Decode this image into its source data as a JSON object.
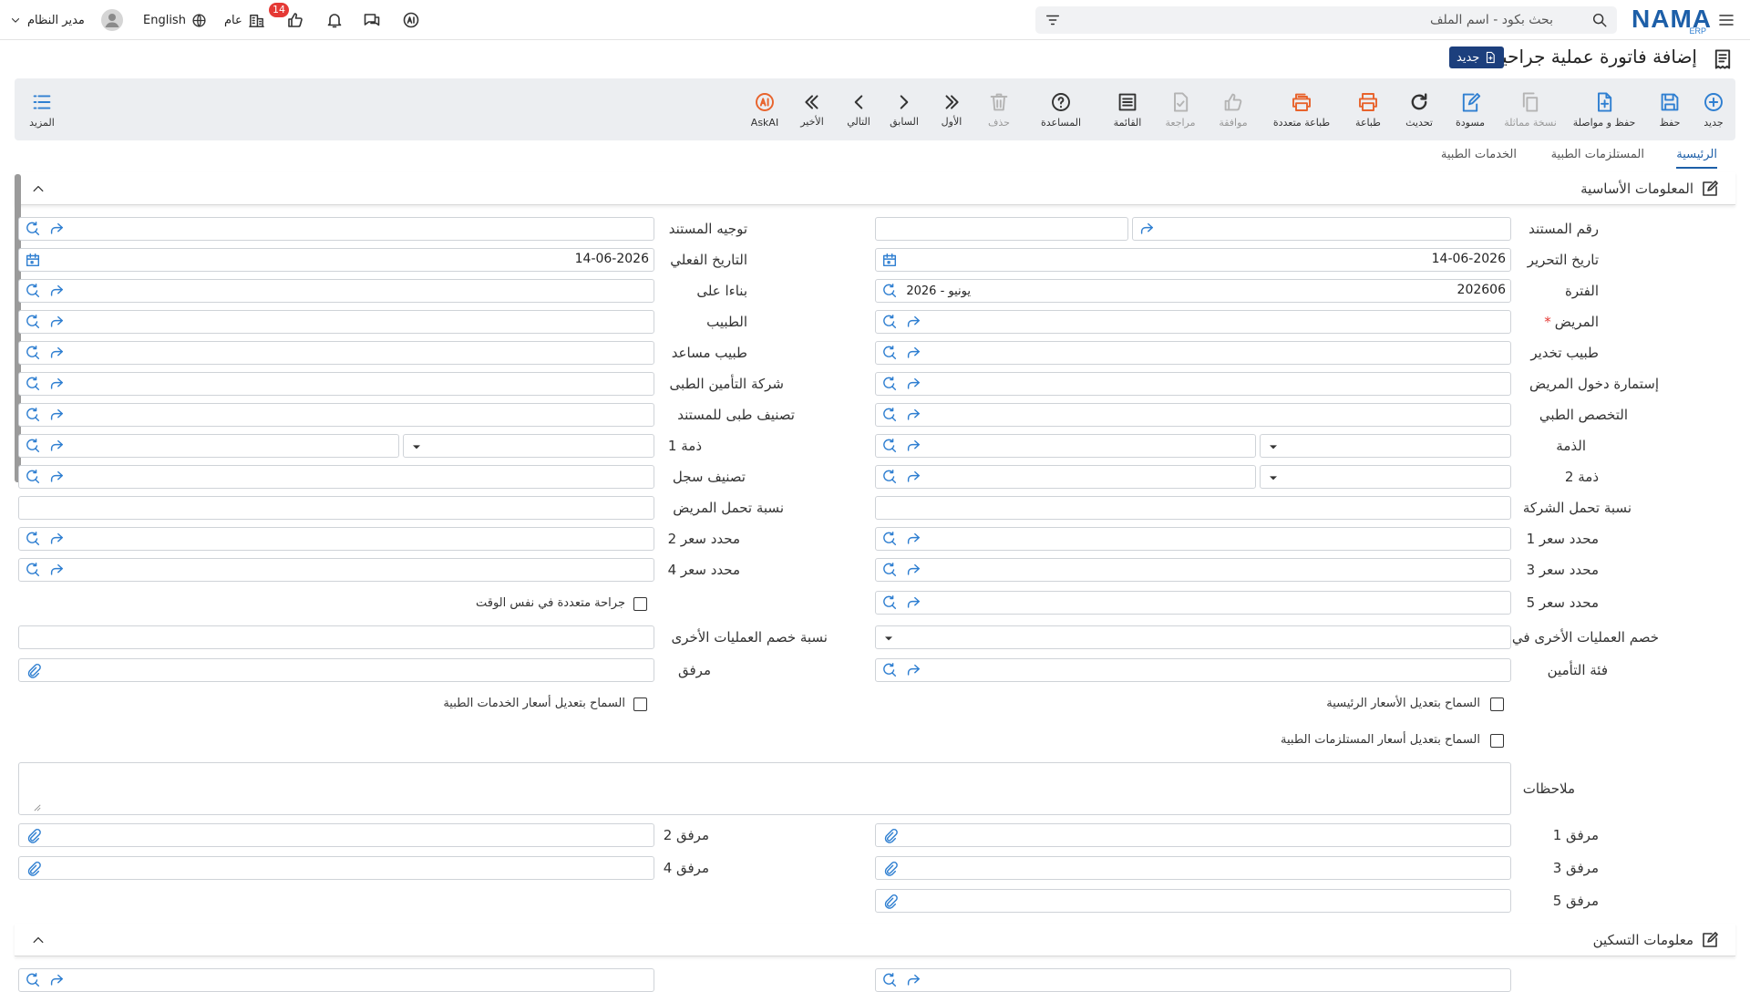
{
  "topbar": {
    "search_placeholder": "بحث بكود - اسم الملف",
    "logo": "NAMA",
    "logo_sub": "ERP",
    "user": "مدير النظام",
    "language": "English",
    "branch": "عام",
    "badge": "14"
  },
  "title": {
    "text": "إضافة فاتورة عملية جراحية",
    "new_badge": "جديد"
  },
  "toolbar": {
    "new": "جديد",
    "save": "حفظ",
    "save_continue": "حفظ و مواصلة",
    "copy": "نسخة مماثلة",
    "draft": "مسودة",
    "refresh": "تحديث",
    "print": "طباعة",
    "multi_print": "طباعة متعددة",
    "approve": "موافقة",
    "review": "مراجعة",
    "list": "القائمة",
    "help": "المساعدة",
    "delete": "حذف",
    "first": "الأول",
    "prev": "السابق",
    "next": "التالي",
    "last": "الأخير",
    "askai": "AskAI",
    "more": "المزيد"
  },
  "tabs": [
    "الرئيسية",
    "المستلزمات الطبية",
    "الخدمات الطبية"
  ],
  "sections": {
    "basic": "المعلومات الأساسية",
    "housing": "معلومات التسكين"
  },
  "form": {
    "doc_no": "رقم المستند",
    "doc_direction": "توجيه المستند",
    "edit_date": "تاريخ التحرير",
    "edit_date_val": "14-06-2026",
    "actual_date": "التاريخ الفعلي",
    "actual_date_val": "14-06-2026",
    "period": "الفترة",
    "period_val": "202606",
    "period_name": "2026 - يونيو",
    "based_on": "بناءا على",
    "patient": "المريض",
    "doctor": "الطبيب",
    "anesthesia": "طبيب تخدير",
    "assistant": "طبيب مساعد",
    "admission": "إستمارة دخول المريض",
    "insurance_co": "شركة التأمين الطبى",
    "specialty": "التخصص الطبي",
    "med_class": "تصنيف طبى للمستند",
    "account": "الذمة",
    "account1": "ذمة 1",
    "account2": "ذمة 2",
    "record_class": "تصنيف سجل",
    "company_share": "نسبة تحمل الشركة",
    "patient_share": "نسبة تحمل المريض",
    "price1": "محدد سعر 1",
    "price2": "محدد سعر 2",
    "price3": "محدد سعر 3",
    "price4": "محدد سعر 4",
    "price5": "محدد سعر 5",
    "multi_surgery": "جراحة متعددة في نفس الوقت",
    "other_discount_in": "خصم العمليات الأخرى في",
    "other_discount_pct": "نسبة خصم العمليات الأخرى",
    "insurance_class": "فئة التأمين",
    "attachment": "مرفق",
    "allow_main_prices": "السماح بتعديل الأسعار الرئيسية",
    "allow_service_prices": "السماح بتعديل أسعار الخدمات الطبية",
    "allow_supply_prices": "السماح بتعديل أسعار المستلزمات الطبية",
    "notes": "ملاحظات",
    "att1": "مرفق 1",
    "att2": "مرفق 2",
    "att3": "مرفق 3",
    "att4": "مرفق 4",
    "att5": "مرفق 5"
  },
  "colors": {
    "brand": "#1d5fa8",
    "accent_blue": "#2f7fd1",
    "print_orange": "#e8632c",
    "required": "#e53935"
  }
}
